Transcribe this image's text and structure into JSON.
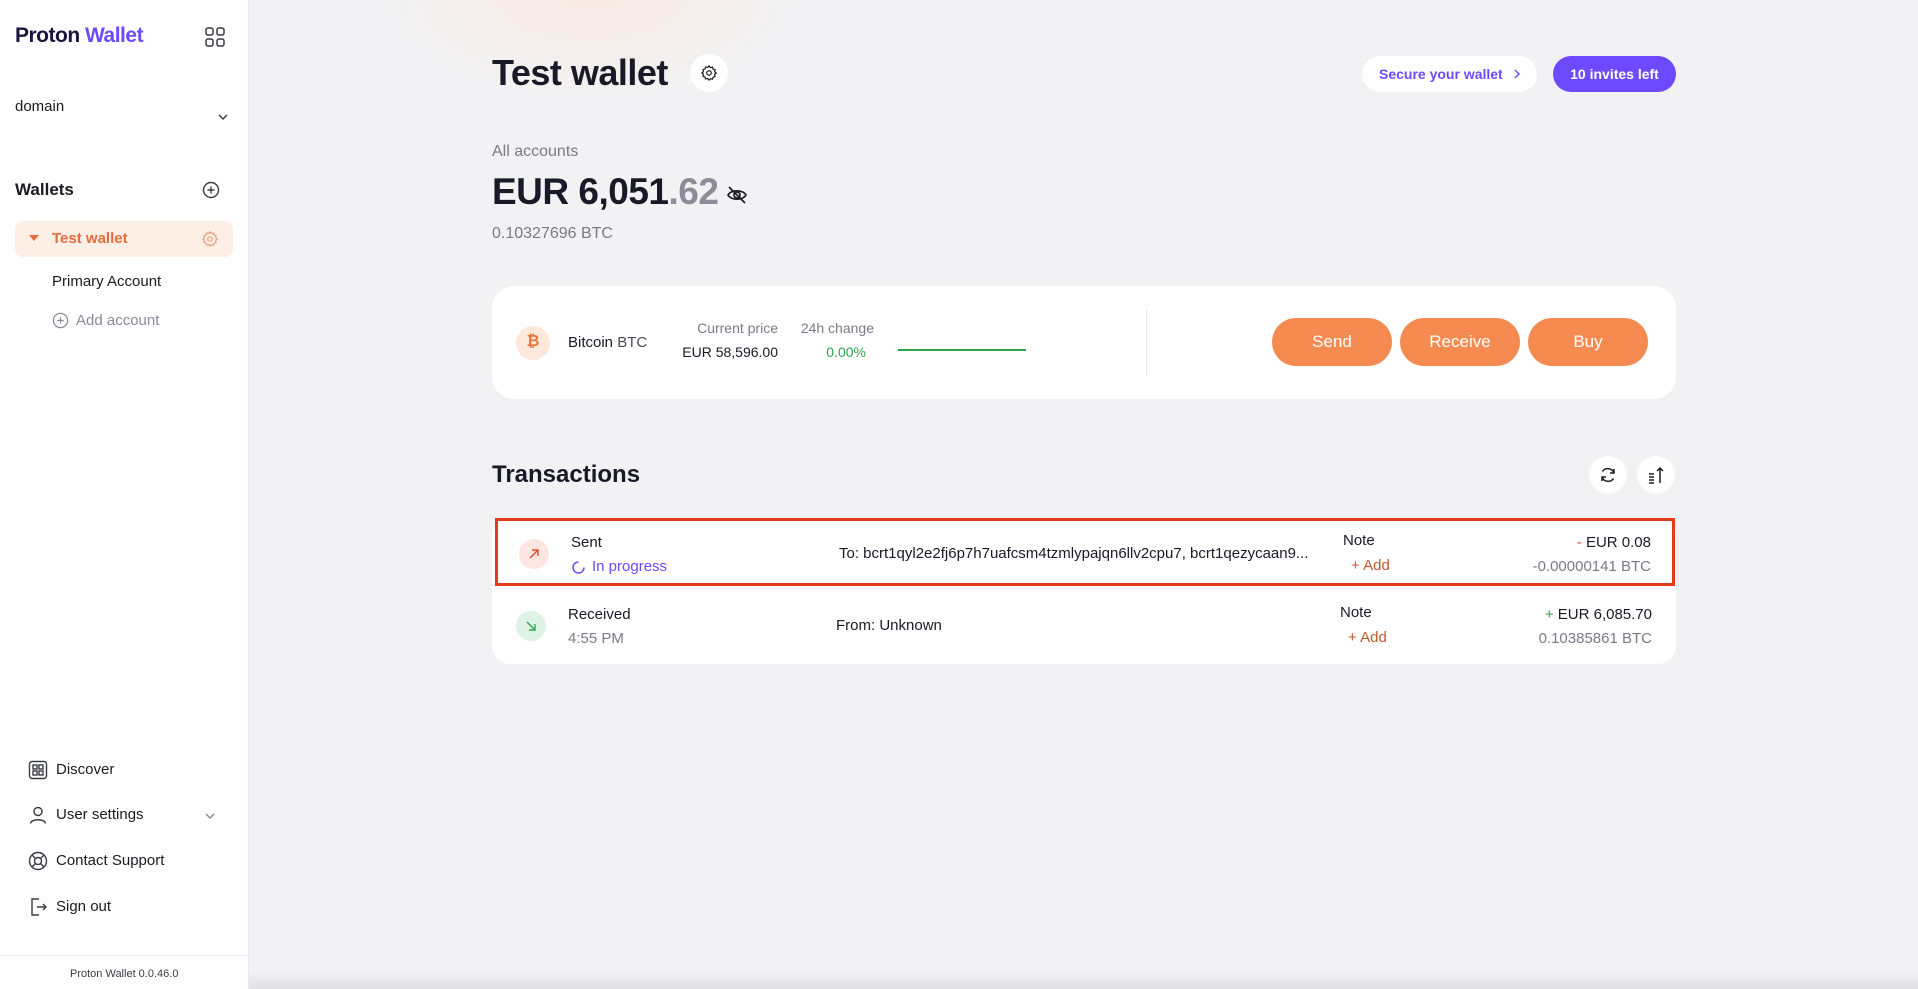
{
  "app": {
    "logo_part1": "Proton",
    "logo_part2": "Wallet",
    "version": "Proton Wallet 0.0.46.0"
  },
  "sidebar": {
    "domain": "domain",
    "wallets_heading": "Wallets",
    "wallet": {
      "name": "Test wallet"
    },
    "accounts": [
      {
        "label": "Primary Account"
      }
    ],
    "add_account": "Add account",
    "nav": [
      {
        "label": "Discover",
        "icon": "discover-icon"
      },
      {
        "label": "User settings",
        "icon": "user-icon"
      },
      {
        "label": "Contact Support",
        "icon": "support-icon"
      },
      {
        "label": "Sign out",
        "icon": "sign-out-icon"
      }
    ]
  },
  "header": {
    "title": "Test wallet",
    "secure_label": "Secure your wallet",
    "invites_label": "10 invites left"
  },
  "balance": {
    "label": "All accounts",
    "currency": "EUR",
    "integer": "6,051",
    "decimal": ".62",
    "btc": "0.10327696 BTC"
  },
  "price": {
    "asset": "Bitcoin",
    "symbol": "BTC",
    "current_price_label": "Current price",
    "current_price": "EUR 58,596.00",
    "change_label": "24h change",
    "change": "0.00%",
    "actions": [
      "Send",
      "Receive",
      "Buy"
    ]
  },
  "transactions": {
    "heading": "Transactions",
    "rows": [
      {
        "type": "Sent",
        "status": "In progress",
        "party": "To: bcrt1qyl2e2fj6p7h7uafcsm4tzmlypajqn6llv2cpu7, bcrt1qezycaan9...",
        "note_label": "Note",
        "note_add": "+ Add",
        "sign": "-",
        "amount": "EUR 0.08",
        "btc": "-0.00000141 BTC"
      },
      {
        "type": "Received",
        "status": "4:55 PM",
        "party": "From: Unknown",
        "note_label": "Note",
        "note_add": "+ Add",
        "sign": "+",
        "amount": "EUR 6,085.70",
        "btc": "0.10385861 BTC"
      }
    ]
  },
  "colors": {
    "accent": "#6d4aff",
    "action": "#f68b52",
    "wallet": "#e56d3c",
    "highlight": "#e43b1d",
    "positive": "#2ea44f"
  }
}
